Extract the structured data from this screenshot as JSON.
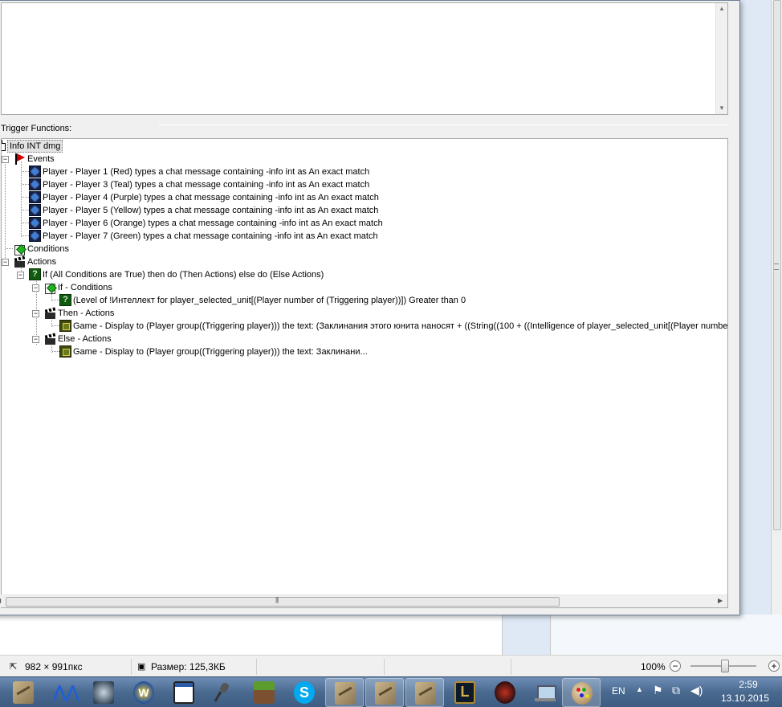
{
  "panel": {
    "label": "Trigger Functions:"
  },
  "tree": {
    "root": "Info INT dmg",
    "events_label": "Events",
    "events": [
      "Player - Player 1 (Red) types a chat message containing -info int as An exact match",
      "Player - Player 3 (Teal) types a chat message containing -info int as An exact match",
      "Player - Player 4 (Purple) types a chat message containing -info int as An exact match",
      "Player - Player 5 (Yellow) types a chat message containing -info int as An exact match",
      "Player - Player 6 (Orange) types a chat message containing -info int as An exact match",
      "Player - Player 7 (Green) types a chat message containing -info int as An exact match"
    ],
    "conditions_label": "Conditions",
    "actions_label": "Actions",
    "if_action": "If (All Conditions are True) then do (Then Actions) else do (Else Actions)",
    "if_conditions_label": "If - Conditions",
    "if_condition": "(Level of !Интеллект  for player_selected_unit[(Player number of (Triggering player))]) Greater than 0",
    "then_actions_label": "Then - Actions",
    "then_action": "Game - Display to (Player group((Triggering player))) the text: (Заклинания этого юнита наносят  + ((String((100 + ((Intelligence of player_selected_unit[(Player number of (Triggering player))] (Include bonuses)) x 1)))) + % урона))",
    "else_actions_label": "Else - Actions",
    "else_action": "Game - Display to (Player group((Triggering player))) the text: Заклинани..."
  },
  "statusbar": {
    "dimensions": "982 × 991пкс",
    "size": "Размер: 125,3КБ",
    "zoom": "100%",
    "zoom_out": "−",
    "zoom_in": "+"
  },
  "taskbar": {
    "apps": [
      "worldedit",
      "msi-afterburner",
      "warcraft-iii",
      "world-of-warcraft",
      "window",
      "microphone",
      "minecraft",
      "skype",
      "worldedit",
      "worldedit",
      "worldedit",
      "league-of-legends",
      "wolf-app",
      "computer",
      "paint"
    ],
    "lang": "EN",
    "time": "2:59",
    "date": "13.10.2015"
  },
  "colors": {
    "taskbar": "#4a6a91",
    "window_border": "#6d7f96",
    "tree_bg": "#ffffff"
  }
}
